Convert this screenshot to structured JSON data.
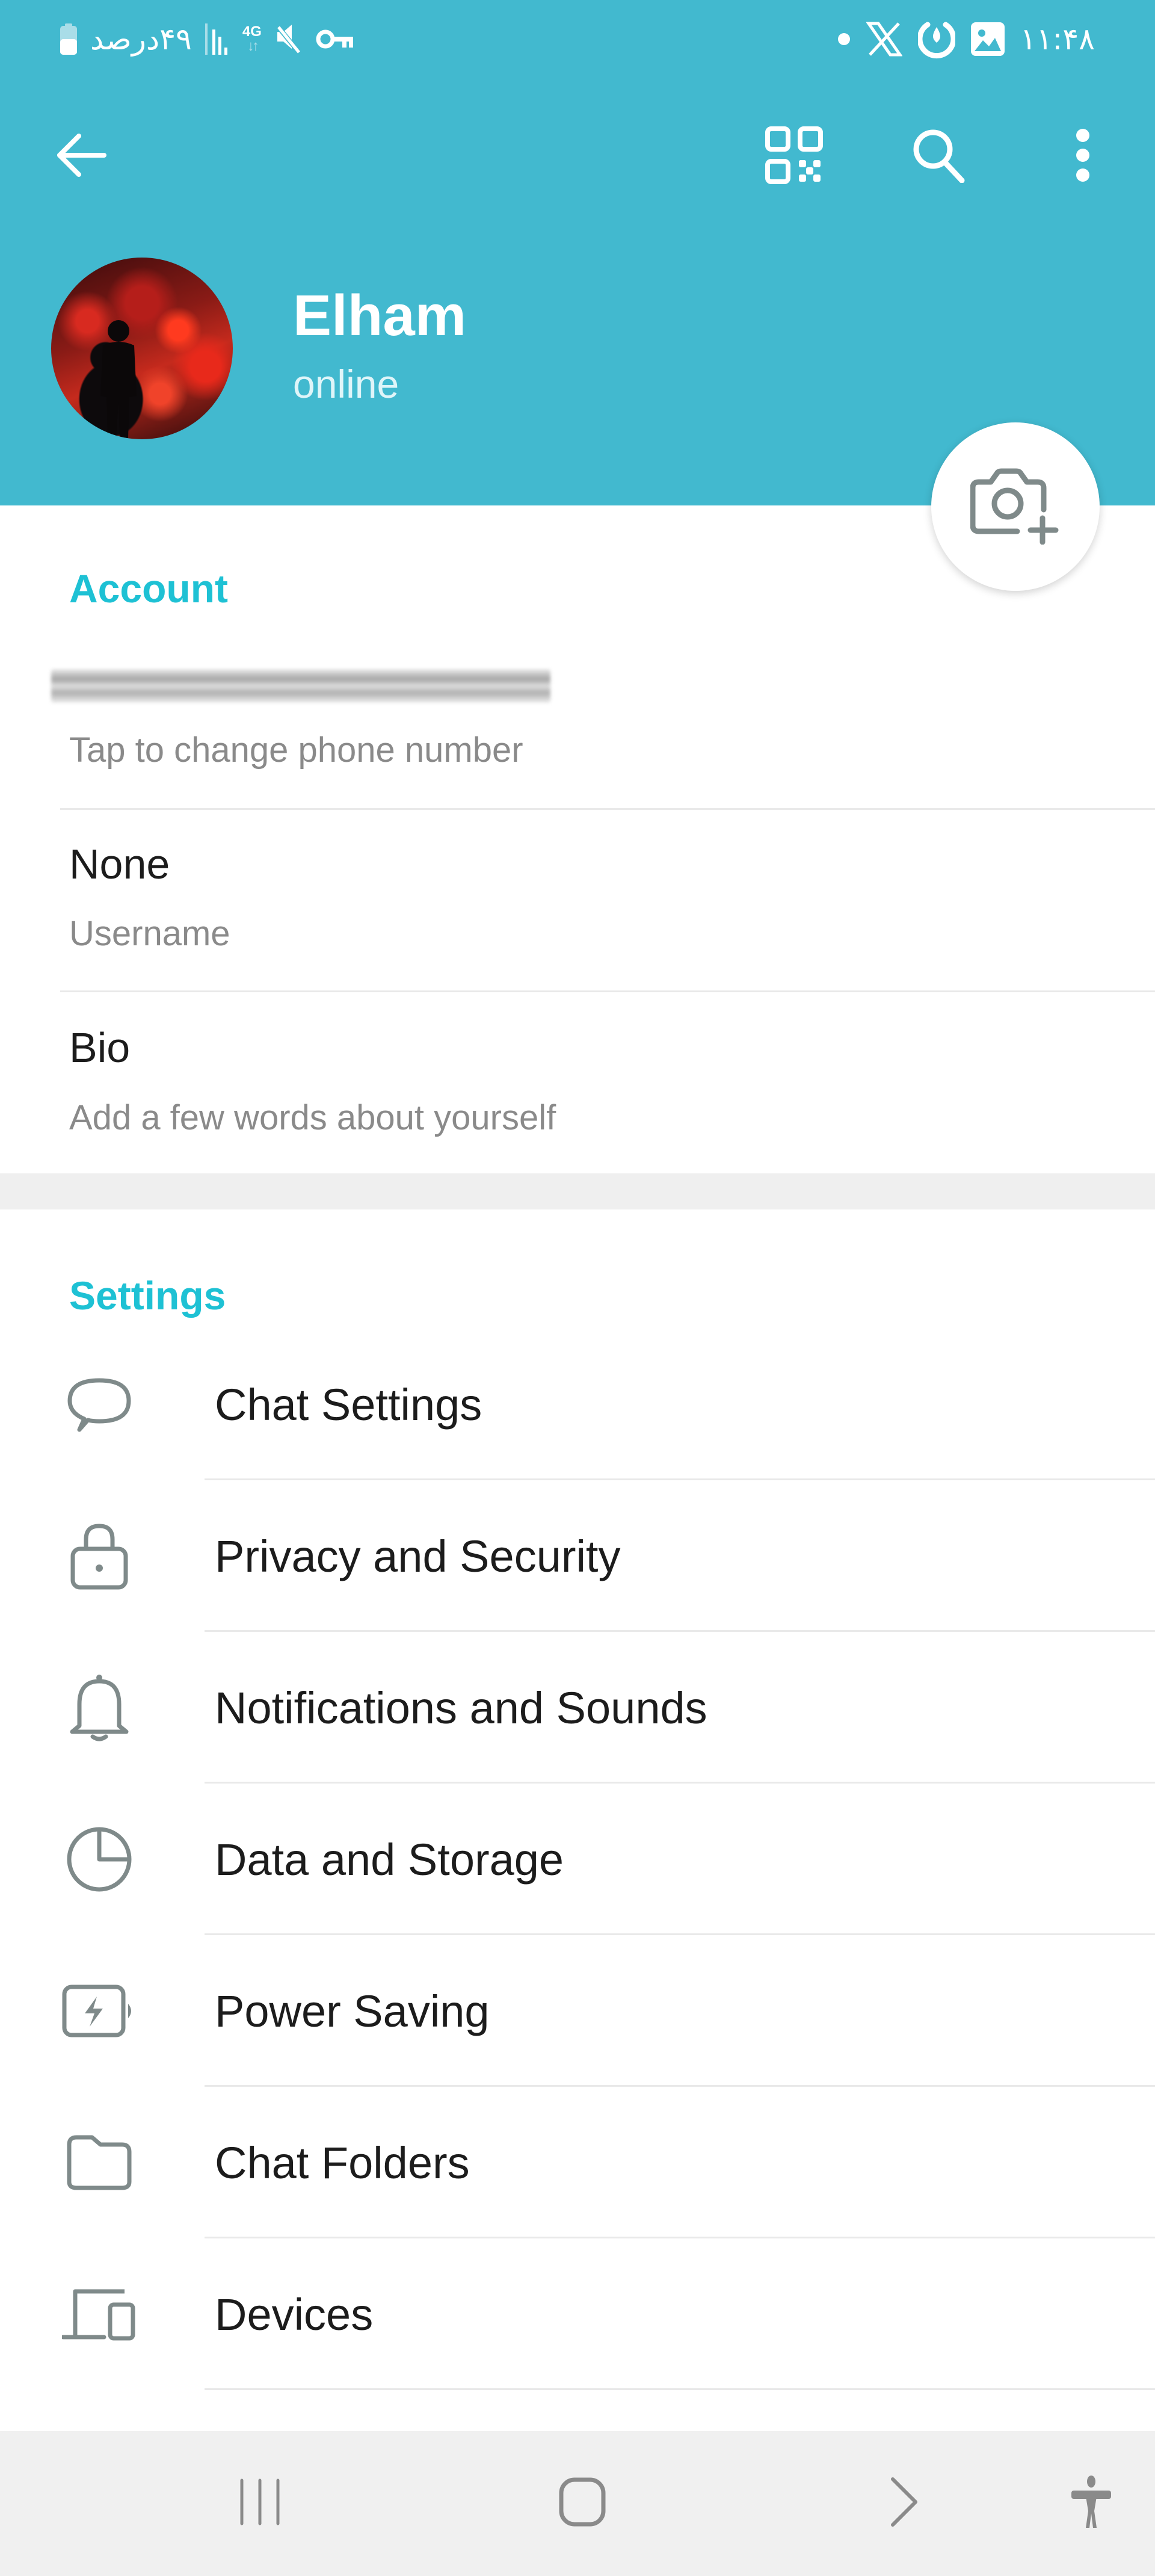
{
  "status_bar": {
    "battery_text": "۴۹درصد",
    "network_type": "4G",
    "time": "۱۱:۴۸",
    "left_icons": [
      "battery-icon",
      "signal-icon",
      "network-4g-icon",
      "mute-icon",
      "vpn-key-icon"
    ],
    "right_icons": [
      "notification-dot-icon",
      "x-app-icon",
      "app-notification-icon",
      "gallery-icon"
    ]
  },
  "app_bar": {
    "back_icon": "arrow-left-icon",
    "actions": [
      "qr-code-icon",
      "search-icon",
      "more-vertical-icon"
    ]
  },
  "profile": {
    "name": "Elham",
    "status": "online",
    "set_photo_icon": "camera-add-icon"
  },
  "account": {
    "title": "Account",
    "phone": {
      "value": "",
      "hint": "Tap to change phone number"
    },
    "username": {
      "value": "None",
      "hint": "Username"
    },
    "bio": {
      "value": "Bio",
      "hint": "Add a few words about yourself"
    }
  },
  "settings": {
    "title": "Settings",
    "items": [
      {
        "label": "Chat Settings",
        "icon": "chat-bubble-icon"
      },
      {
        "label": "Privacy and Security",
        "icon": "lock-icon"
      },
      {
        "label": "Notifications and Sounds",
        "icon": "bell-icon"
      },
      {
        "label": "Data and Storage",
        "icon": "pie-chart-icon"
      },
      {
        "label": "Power Saving",
        "icon": "battery-bolt-icon"
      },
      {
        "label": "Chat Folders",
        "icon": "folder-icon"
      },
      {
        "label": "Devices",
        "icon": "devices-icon"
      }
    ]
  },
  "nav_bar": {
    "buttons": [
      "recents-icon",
      "home-icon",
      "back-chevron-icon",
      "accessibility-icon"
    ]
  },
  "colors": {
    "header_bg": "#42b9cf",
    "accent_text": "#1ec1d4",
    "icon_gray": "#7f8a8a",
    "primary_text": "#1c1c1c",
    "secondary_text": "#8a8a8a",
    "nav_bg": "#f0f0f0"
  }
}
